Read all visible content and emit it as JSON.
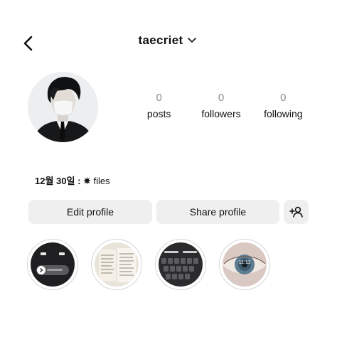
{
  "header": {
    "username": "taecriet",
    "back_icon": "chevron-left-icon",
    "switch_icon": "chevron-down-icon"
  },
  "profile": {
    "stats": [
      {
        "value": "0",
        "label": "posts"
      },
      {
        "value": "0",
        "label": "followers"
      },
      {
        "value": "0",
        "label": "following"
      }
    ],
    "bio_date": "12월 30일 : ",
    "bio_star": "✷",
    "bio_text": " files"
  },
  "actions": {
    "edit_label": "Edit profile",
    "share_label": "Share profile",
    "add_user_icon": "person-add-icon"
  },
  "highlights": {
    "first_time": "",
    "fourth_overlay": "11:11"
  },
  "colors": {
    "button_bg": "#efefef",
    "stat_number": "#8a8a8a",
    "text": "#111111"
  }
}
